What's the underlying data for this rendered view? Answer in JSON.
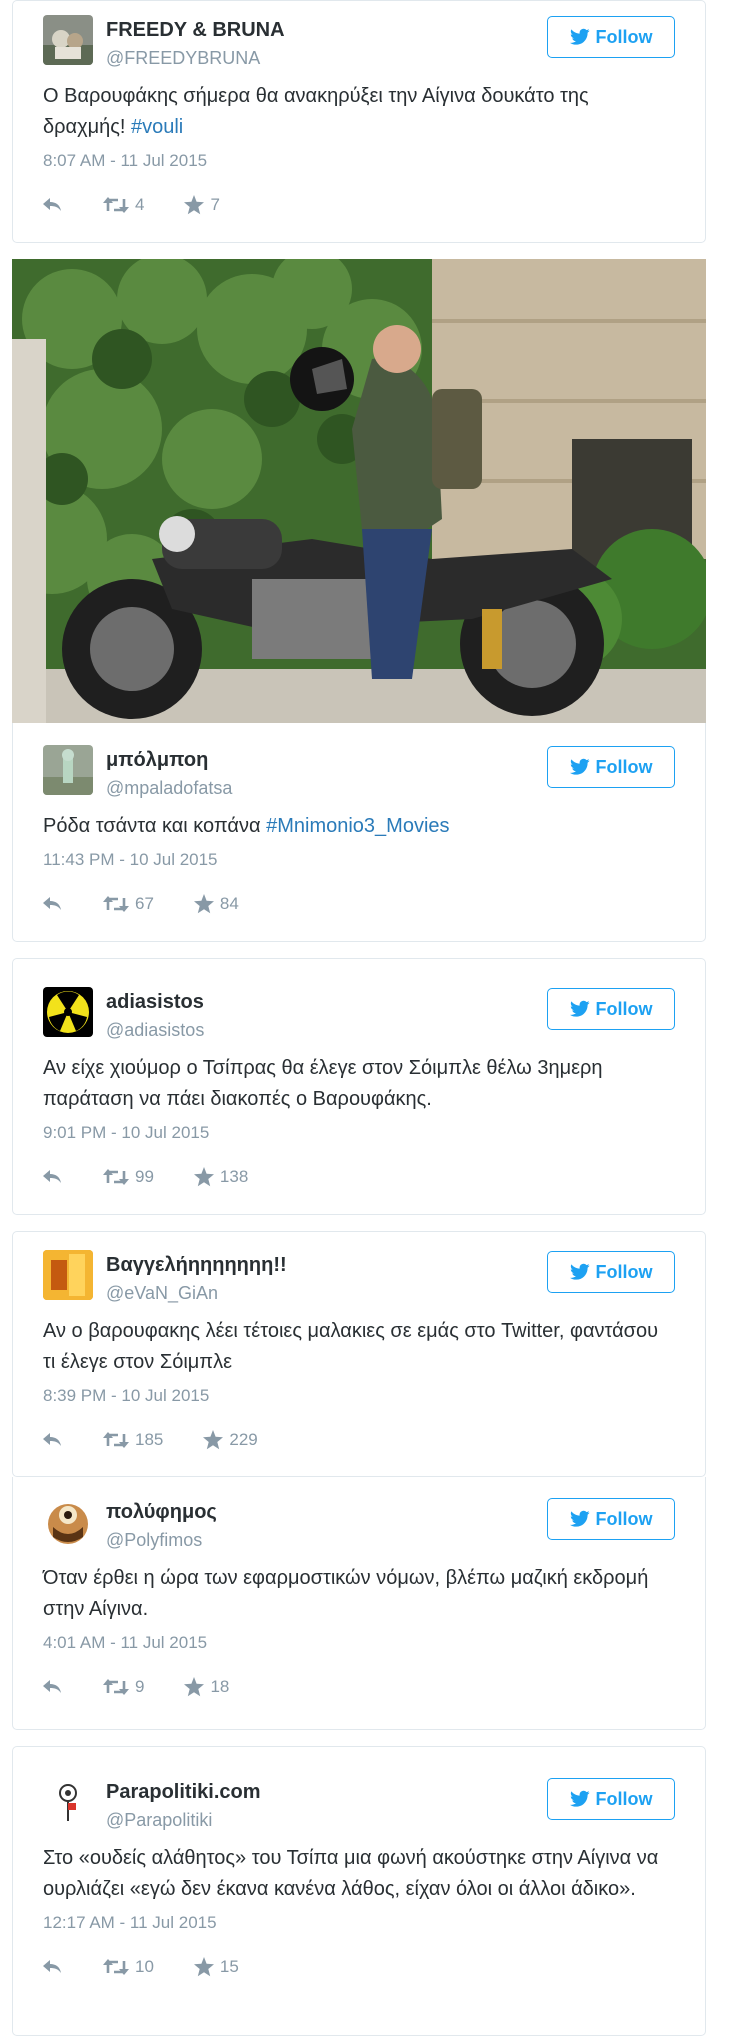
{
  "follow_label": "Follow",
  "colors": {
    "accent": "#1da1f2",
    "hashtag": "#2b7bb9",
    "muted": "#8899a6",
    "border": "#e1e8ed"
  },
  "tweets": [
    {
      "name": "FREEDY & BRUNA",
      "handle": "@FREEDYBRUNA",
      "text_before": "Ο Βαρουφάκης σήμερα θα ανακηρύξει την Αίγινα δουκάτο της δραχμής! ",
      "hashtag": "#vouli",
      "time": "8:07 AM - 11 Jul 2015",
      "retweets": "4",
      "favorites": "7"
    },
    {
      "name": "μπόλμποη",
      "handle": "@mpaladofatsa",
      "text_before": "Ρόδα τσάντα και κοπάνα ",
      "hashtag": "#Mnimonio3_Movies",
      "time": "11:43 PM - 10 Jul 2015",
      "retweets": "67",
      "favorites": "84"
    },
    {
      "name": "adiasistos",
      "handle": "@adiasistos",
      "text": "Αν είχε χιούμορ ο Τσίπρας θα έλεγε στον Σόιμπλε θέλω 3ημερη παράταση να πάει διακοπές ο Βαρουφάκης.",
      "time": "9:01 PM - 10 Jul 2015",
      "retweets": "99",
      "favorites": "138"
    },
    {
      "name": "Βαγγελήηηηηηηη!!",
      "handle": "@eVaN_GiAn",
      "text": "Αν ο βαρουφακης λέει τέτοιες μαλακιες σε εμάς στο Twitter, φαντάσου τι έλεγε στον Σόιμπλε",
      "time": "8:39 PM - 10 Jul 2015",
      "retweets": "185",
      "favorites": "229"
    },
    {
      "name": "πολύφημος",
      "handle": "@Polyfimos",
      "text": "Όταν έρθει η ώρα των εφαρμοστικών νόμων, βλέπω μαζική εκδρομή στην Αίγινα.",
      "time": "4:01 AM - 11 Jul 2015",
      "retweets": "9",
      "favorites": "18"
    },
    {
      "name": "Parapolitiki.com",
      "handle": "@Parapolitiki",
      "text": "Στο «ουδείς αλάθητος» του Τσίπα μια φωνή ακούστηκε στην Αίγινα να ουρλιάζει «εγώ δεν έκανα κανένα λάθος, είχαν όλοι οι άλλοι άδικο».",
      "time": "12:17 AM - 11 Jul 2015",
      "retweets": "10",
      "favorites": "15"
    }
  ],
  "icons": {
    "reply": "reply-icon",
    "retweet": "retweet-icon",
    "favorite": "star-icon",
    "follow": "twitter-bird-icon"
  }
}
